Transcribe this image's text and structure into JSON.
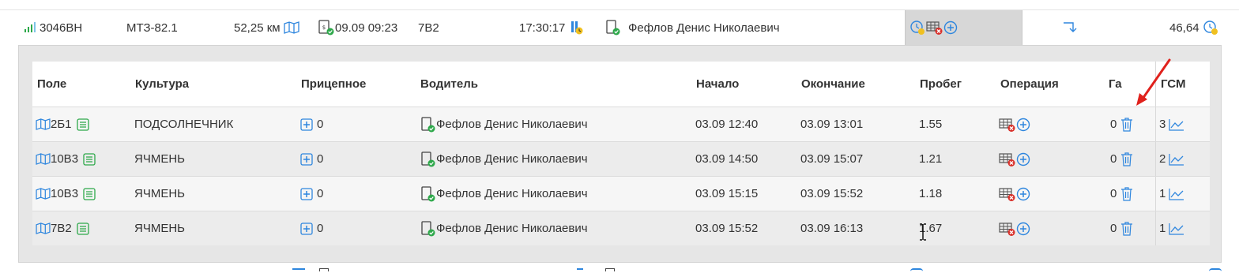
{
  "vehicle_row": {
    "plate": "3046ВН",
    "model": "МТЗ-82.1",
    "distance": "52,25 км",
    "last_seen": "09.09 09:23",
    "field": "7В2",
    "duration": "17:30:17",
    "driver": "Фефлов Денис Николаевич",
    "fuel": "46,64"
  },
  "table": {
    "headers": {
      "field": "Поле",
      "crop": "Культура",
      "trailer": "Прицепное",
      "driver": "Водитель",
      "start": "Начало",
      "end": "Окончание",
      "mileage": "Пробег",
      "operation": "Операция",
      "ha": "Га",
      "fuel": "ГСМ"
    },
    "rows": [
      {
        "field": "2Б1",
        "crop": "ПОДСОЛНЕЧНИК",
        "trailer": "0",
        "driver": "Фефлов Денис Николаевич",
        "start": "03.09 12:40",
        "end": "03.09 13:01",
        "mileage": "1.55",
        "ha": "0",
        "fuel": "3"
      },
      {
        "field": "10В3",
        "crop": "ЯЧМЕНЬ",
        "trailer": "0",
        "driver": "Фефлов Денис Николаевич",
        "start": "03.09 14:50",
        "end": "03.09 15:07",
        "mileage": "1.21",
        "ha": "0",
        "fuel": "2"
      },
      {
        "field": "10В3",
        "crop": "ЯЧМЕНЬ",
        "trailer": "0",
        "driver": "Фефлов Денис Николаевич",
        "start": "03.09 15:15",
        "end": "03.09 15:52",
        "mileage": "1.18",
        "ha": "0",
        "fuel": "1"
      },
      {
        "field": "7В2",
        "crop": "ЯЧМЕНЬ",
        "trailer": "0",
        "driver": "Фефлов Денис Николаевич",
        "start": "03.09 15:52",
        "end": "03.09 16:13",
        "mileage": "1.67",
        "ha": "0",
        "fuel": "1"
      }
    ]
  },
  "colors": {
    "accent_blue": "#2e86de",
    "ok_green": "#2da84a",
    "error_red": "#d9302a",
    "warn_yellow": "#f0c020",
    "annotation_arrow": "#e0211c"
  }
}
